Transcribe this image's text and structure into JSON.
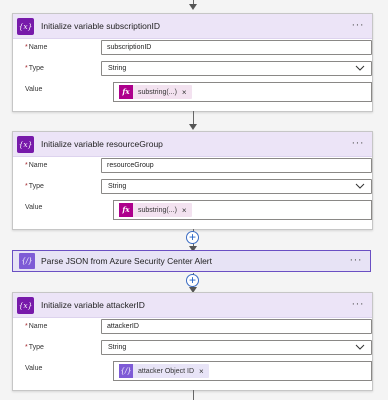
{
  "flow": {
    "steps": [
      {
        "title": "Initialize variable subscriptionID",
        "icon": "{x}",
        "fields": {
          "name_label": "Name",
          "name_value": "subscriptionID",
          "type_label": "Type",
          "type_value": "String",
          "value_label": "Value",
          "token_icon": "fx",
          "token_label": "substring(...)",
          "token_close": "×"
        }
      },
      {
        "title": "Initialize variable resourceGroup",
        "icon": "{x}",
        "fields": {
          "name_label": "Name",
          "name_value": "resourceGroup",
          "type_label": "Type",
          "type_value": "String",
          "value_label": "Value",
          "token_icon": "fx",
          "token_label": "substring(...)",
          "token_close": "×"
        }
      },
      {
        "title": "Parse JSON from Azure Security Center Alert",
        "icon": "{/}"
      },
      {
        "title": "Initialize variable attackerID",
        "icon": "{x}",
        "fields": {
          "name_label": "Name",
          "name_value": "attackerID",
          "type_label": "Type",
          "type_value": "String",
          "value_label": "Value",
          "token_icon": "{/}",
          "token_label": "attacker Object ID",
          "token_close": "×"
        }
      }
    ],
    "menu_glyph": "···",
    "required_marker": "*",
    "add_step_glyph": "+"
  },
  "colors": {
    "variable_icon": "#7719aa",
    "variable_header": "#ece4f7",
    "expression_token": "#ad008c",
    "parse_json_icon": "#7e5bd6",
    "connector": "#666666",
    "add_button_border": "#3b6cc3"
  },
  "icons": {
    "variable": "variable-curly-x-icon",
    "expression": "fx-icon",
    "parse_json": "parse-json-icon",
    "dropdown": "chevron-down-icon",
    "more": "more-options-icon",
    "add": "plus-icon"
  }
}
